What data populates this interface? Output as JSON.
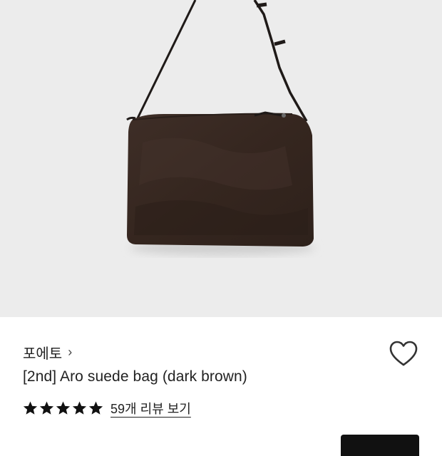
{
  "product_image": {
    "description_icon": "bag-photo",
    "background_color": "#ececec"
  },
  "brand": {
    "name": "포에토",
    "chevron": "›"
  },
  "product": {
    "title": "[2nd] Aro suede bag (dark brown)"
  },
  "rating": {
    "stars": 5,
    "max_stars": 5,
    "reviews_label": "59개 리뷰 보기"
  },
  "colors": {
    "bag": "#3b2c25",
    "strap": "#1f1a18",
    "star": "#111111",
    "accent_button": "#111111"
  },
  "icons": {
    "wishlist": "heart-outline-icon",
    "chevron": "chevron-right-icon",
    "star": "star-icon"
  }
}
